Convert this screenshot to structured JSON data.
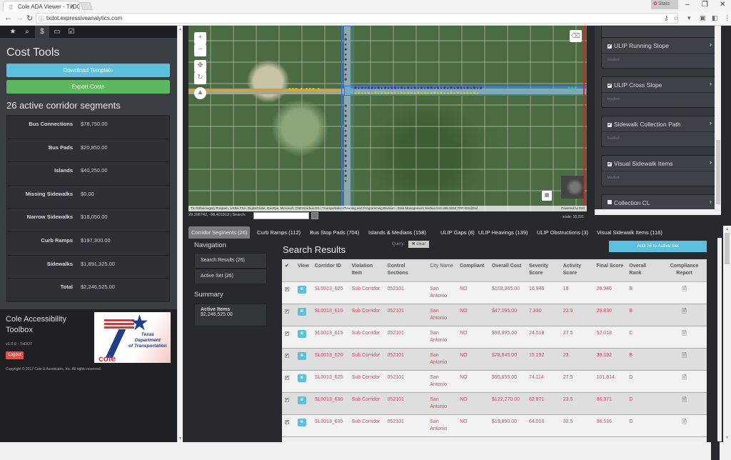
{
  "browser": {
    "tab_title": "Cole ADA Viewer - TxDOT",
    "url": "txdot.expressiveanalytics.com",
    "user_label": "Stats",
    "icons": [
      "back-icon",
      "forward-icon",
      "reload-icon",
      "info-icon",
      "key-icon",
      "star-icon",
      "extension-icon",
      "menu-icon"
    ]
  },
  "sidebar": {
    "tabs": [
      {
        "icon": "★",
        "name": "favorites"
      },
      {
        "icon": "⌕",
        "name": "search"
      },
      {
        "icon": "$",
        "name": "cost"
      },
      {
        "icon": "▭",
        "name": "layers"
      },
      {
        "icon": "☑",
        "name": "tasks"
      }
    ],
    "cost_title": "Cost Tools",
    "download_label": "Download Template",
    "export_label": "Export Costs",
    "segments_title": "26 active corridor segments",
    "costs": [
      {
        "label": "Bus Connections",
        "value": "$78,750.00"
      },
      {
        "label": "Bus Pads",
        "value": "$20,850.00"
      },
      {
        "label": "Islands",
        "value": "$40,250.00"
      },
      {
        "label": "Missing Sidewalks",
        "value": "$0.00"
      },
      {
        "label": "Narrow Sidewalks",
        "value": "$18,050.00"
      },
      {
        "label": "Curb Ramps",
        "value": "$197,300.00"
      },
      {
        "label": "Sidewalks",
        "value": "$1,891,325.00"
      },
      {
        "label": "Total",
        "value": "$2,246,525.00"
      }
    ],
    "brand_title": "Cole Accessibility Toolbox",
    "version": "v1.0.9 - TxDOT",
    "logout_label": "Logout",
    "copyright": "Copyright © 2017 Cole & Associates, Inc. All rights reserved.",
    "logo": {
      "line1": "Texas",
      "line2": "Department",
      "line3": "of Transportation",
      "cole": "cole"
    }
  },
  "map": {
    "attribution": "TX Orthoimagery Program, USDA FSA, DigitalGlobe, GeoEye, Microsoft, CNES/Airbus DS | Transportation Planning and Programming Division - Data Management Section 512-486-5052 TPP-GIS@txd",
    "powered": "Powered by Esri",
    "coords": "29.396742, -98.401913 | Search:",
    "scale": "scale: 10,231",
    "controls": [
      "+",
      "−",
      "✥",
      "↻",
      "▲"
    ]
  },
  "layers": [
    {
      "name": "ULIP Running Slope",
      "status": "loaded",
      "checked": true
    },
    {
      "name": "ULIP Cross Slope",
      "status": "loaded",
      "checked": true
    },
    {
      "name": "Sidewalk Collection Path",
      "status": "loaded",
      "checked": true
    },
    {
      "name": "Visual Sidewalk Items",
      "status": "loaded",
      "checked": true
    },
    {
      "name": "Collection CL",
      "status": "",
      "checked": false
    }
  ],
  "feature_tabs": [
    "Corridor Segments (26)",
    "Curb Ramps (112)",
    "Bus Stop Pads (704)",
    "Islands & Medians (158)",
    "ULIP Gaps (8)",
    "ULIP Heavings (139)",
    "ULIP Obstructions (3)",
    "Visual Sidewalk Items (116)"
  ],
  "navigation": {
    "title": "Navigation",
    "items": [
      "Search Results (26)",
      "Active Set (26)"
    ],
    "summary_title": "Summary",
    "summary_label": "Active Items",
    "summary_value": "$2,246,525.00"
  },
  "results": {
    "title": "Search Results",
    "query_label": "Query:",
    "clear_label": "✖ clear",
    "add_label": "Add 26 to Active Set",
    "columns": [
      "✔",
      "View",
      "Corridor ID",
      "Violation Item",
      "Control Sections",
      "City Name",
      "Compliant",
      "Overall Cost",
      "Severity Score",
      "Activity Score",
      "Final Score",
      "Overall Rank",
      "Compliance Report"
    ],
    "rows": [
      {
        "id": "SL0013_605",
        "item": "Sub Corridor",
        "cs": "052101",
        "city": "San Antonio",
        "compliant": "NO",
        "cost": "$103,365.00",
        "sev": "10.946",
        "act": "18",
        "final": "28.946",
        "rank": "B"
      },
      {
        "id": "SL0013_610",
        "item": "Sub Corridor",
        "cs": "052101",
        "city": "San Antonio",
        "compliant": "NO",
        "cost": "$47,095.00",
        "sev": "7.330",
        "act": "22.5",
        "final": "29.830",
        "rank": "B"
      },
      {
        "id": "SL0013_615",
        "item": "Sub Corridor",
        "cs": "052101",
        "city": "San Antonio",
        "compliant": "NO",
        "cost": "$93,995.00",
        "sev": "24.518",
        "act": "27.5",
        "final": "52.018",
        "rank": "C"
      },
      {
        "id": "SL0013_620",
        "item": "Sub Corridor",
        "cs": "052101",
        "city": "San Antonio",
        "compliant": "NO",
        "cost": "$78,845.00",
        "sev": "15.192",
        "act": "23",
        "final": "38.192",
        "rank": "B"
      },
      {
        "id": "SL0013_625",
        "item": "Sub Corridor",
        "cs": "052101",
        "city": "San Antonio",
        "compliant": "NO",
        "cost": "$95,655.00",
        "sev": "74.114",
        "act": "27.5",
        "final": "101.614",
        "rank": "D"
      },
      {
        "id": "SL0013_630",
        "item": "Sub Corridor",
        "cs": "052101",
        "city": "San Antonio",
        "compliant": "NO",
        "cost": "$122,270.00",
        "sev": "62.871",
        "act": "23.5",
        "final": "86.371",
        "rank": "D"
      },
      {
        "id": "SL0013_635",
        "item": "Sub Corridor",
        "cs": "052101",
        "city": "San Antonio",
        "compliant": "NO",
        "cost": "$19,890.00",
        "sev": "64.016",
        "act": "32.5",
        "final": "96.516",
        "rank": "D"
      }
    ]
  }
}
